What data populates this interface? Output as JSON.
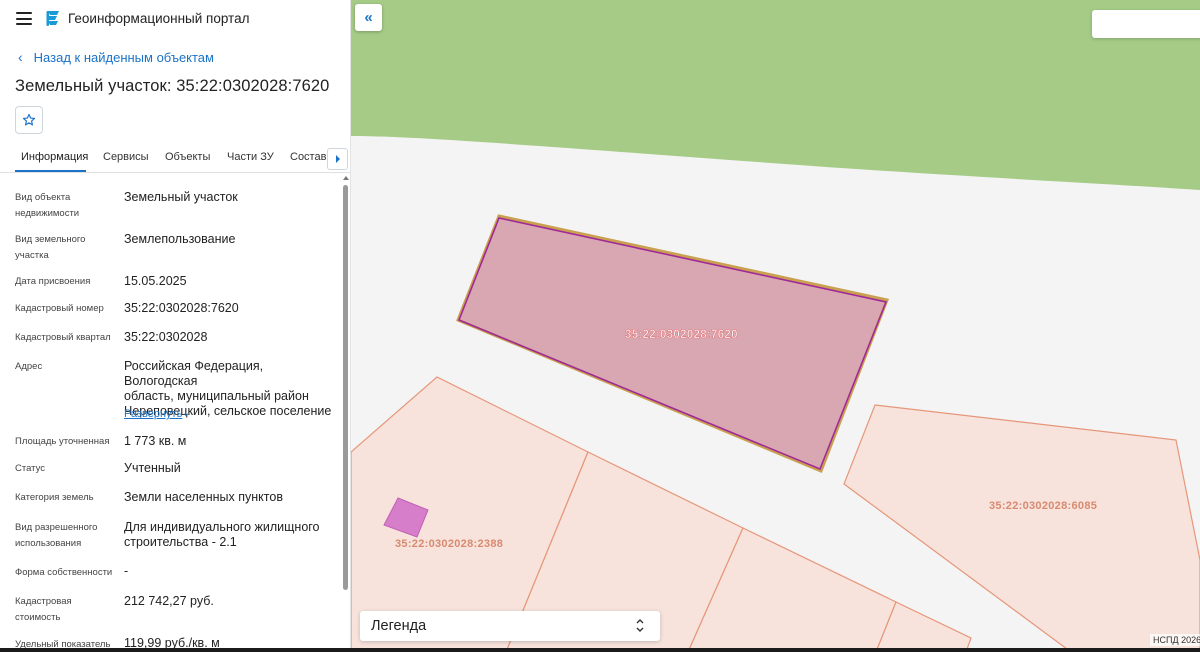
{
  "app": {
    "title": "Геоинформационный портал"
  },
  "header": {
    "back_label": "Назад к найденным объектам",
    "page_title": "Земельный участок: 35:22:0302028:7620"
  },
  "tabs": [
    {
      "label": "Информация",
      "active": true
    },
    {
      "label": "Сервисы",
      "active": false
    },
    {
      "label": "Объекты",
      "active": false
    },
    {
      "label": "Части ЗУ",
      "active": false
    },
    {
      "label": "Состав",
      "active": false
    }
  ],
  "info": {
    "object_type": {
      "label_1": "Вид объекта",
      "label_2": "недвижимости",
      "value": "Земельный участок"
    },
    "land_type": {
      "label_1": "Вид земельного",
      "label_2": "участка",
      "value": "Землепользование"
    },
    "assigned_date": {
      "label": "Дата присвоения",
      "value": "15.05.2025"
    },
    "cadastral_number": {
      "label": "Кадастровый номер",
      "value": "35:22:0302028:7620"
    },
    "cadastral_quarter": {
      "label": "Кадастровый квартал",
      "value": "35:22:0302028"
    },
    "address": {
      "label": "Адрес",
      "line_1": "Российская Федерация, Вологодская",
      "line_2": "область, муниципальный район",
      "line_3": "Череповецкий, сельское поселение",
      "expand_label": "Развернуть"
    },
    "area": {
      "label": "Площадь уточненная",
      "value": "1 773 кв. м"
    },
    "status": {
      "label": "Статус",
      "value": "Учтенный"
    },
    "land_category": {
      "label": "Категория земель",
      "value": "Земли населенных пунктов"
    },
    "permitted_use": {
      "label_1": "Вид разрешенного",
      "label_2": "использования",
      "value_1": "Для индивидуального жилищного",
      "value_2": "строительства - 2.1"
    },
    "ownership": {
      "label": "Форма собственности",
      "value": "-"
    },
    "cadastral_value": {
      "label_1": "Кадастровая",
      "label_2": "стоимость",
      "value": "212 742,27 руб."
    },
    "specific_value": {
      "label": "Удельный показатель",
      "value": "119,99 руб./кв. м"
    }
  },
  "map": {
    "parcel_main_label": "35:22:0302028:7620",
    "parcel_left_label": "35:22:0302028:2388",
    "parcel_right_label": "35:22:0302028:6085",
    "legend_label": "Легенда",
    "attribution": "НСПД 2026",
    "colors": {
      "green_area": "#a5cb86",
      "background": "#f4f4f4",
      "selected_fill": "#d9a7b1",
      "selected_stroke": "#a0299a",
      "parcel_fill": "#f7e3dc",
      "parcel_stroke": "#e6967a",
      "parcel_label": "#d88a70",
      "building_fill": "#d77ecb"
    }
  }
}
